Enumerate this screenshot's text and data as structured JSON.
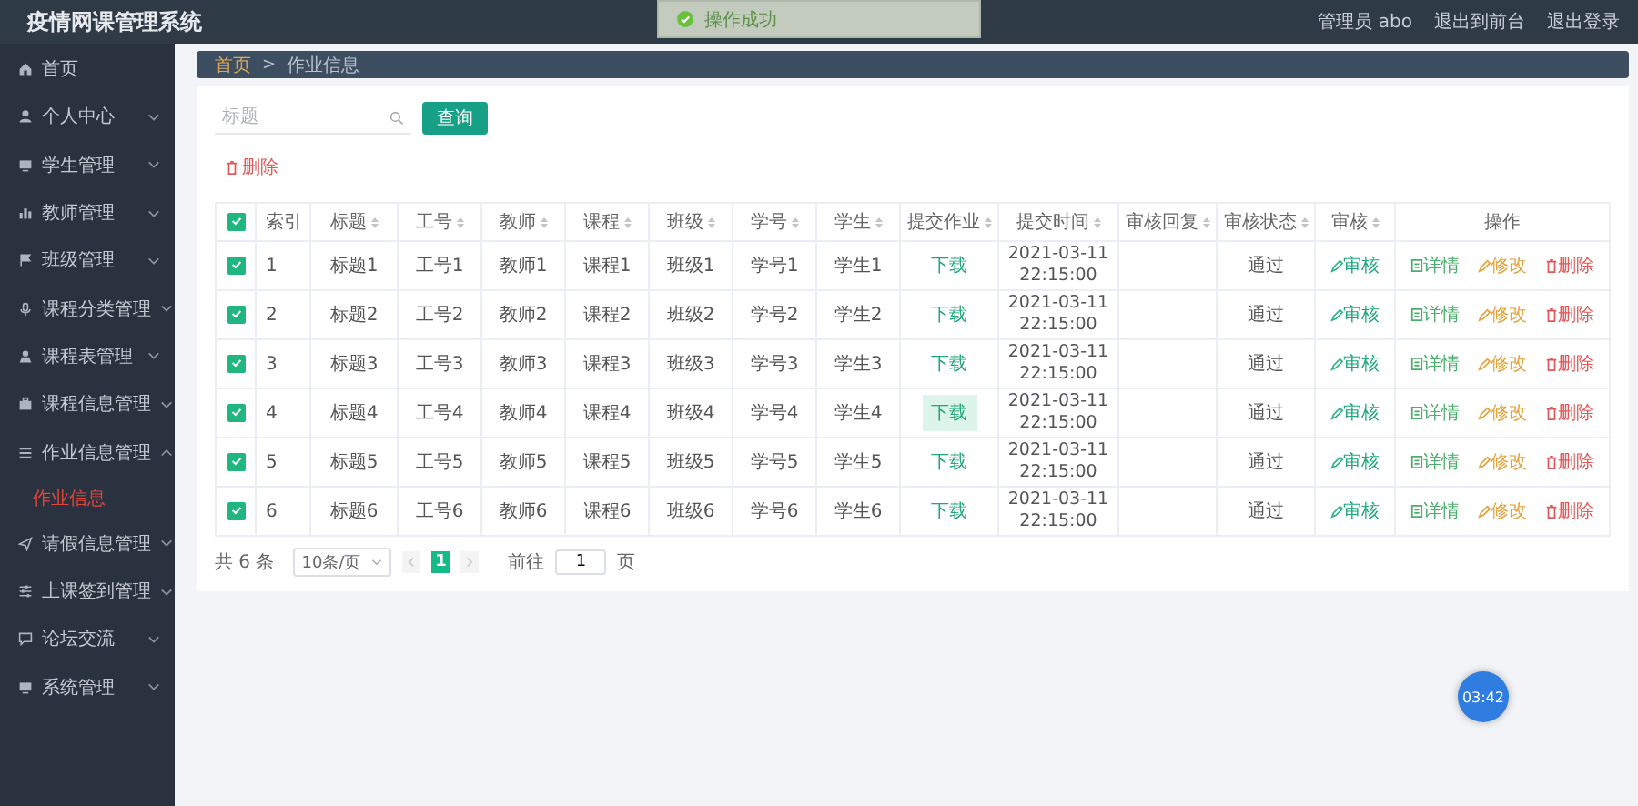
{
  "app_title": "疫情网课管理系统",
  "toast": {
    "text": "操作成功"
  },
  "user_menu": [
    "管理员 abo",
    "退出到前台",
    "退出登录"
  ],
  "sidebar": {
    "items": [
      {
        "label": "首页"
      },
      {
        "label": "个人中心",
        "expanded": false
      },
      {
        "label": "学生管理",
        "expanded": false
      },
      {
        "label": "教师管理",
        "expanded": false
      },
      {
        "label": "班级管理",
        "expanded": false
      },
      {
        "label": "课程分类管理",
        "expanded": false
      },
      {
        "label": "课程表管理",
        "expanded": false
      },
      {
        "label": "课程信息管理",
        "expanded": false
      },
      {
        "label": "作业信息管理",
        "expanded": true,
        "children": [
          {
            "label": "作业信息",
            "selected": true
          }
        ]
      },
      {
        "label": "请假信息管理",
        "expanded": false
      },
      {
        "label": "上课签到管理",
        "expanded": false
      },
      {
        "label": "论坛交流",
        "expanded": false
      },
      {
        "label": "系统管理",
        "expanded": false
      }
    ]
  },
  "breadcrumb": {
    "items": [
      "首页",
      "作业信息"
    ],
    "separator": ">"
  },
  "search": {
    "placeholder": "标题",
    "button": "查询"
  },
  "delete_button": "删除",
  "table": {
    "all_checked": true,
    "columns": [
      {
        "label": "索引",
        "sortable": false
      },
      {
        "label": "标题",
        "sortable": true
      },
      {
        "label": "工号",
        "sortable": true
      },
      {
        "label": "教师",
        "sortable": true
      },
      {
        "label": "课程",
        "sortable": true
      },
      {
        "label": "班级",
        "sortable": true
      },
      {
        "label": "学号",
        "sortable": true
      },
      {
        "label": "学生",
        "sortable": true
      },
      {
        "label": "提交作业",
        "sortable": true
      },
      {
        "label": "提交时间",
        "sortable": true
      },
      {
        "label": "审核回复",
        "sortable": true
      },
      {
        "label": "审核状态",
        "sortable": true
      },
      {
        "label": "审核",
        "sortable": true
      },
      {
        "label": "操作",
        "sortable": false
      }
    ],
    "rows": [
      {
        "checked": true,
        "cells": [
          "1",
          "标题1",
          "工号1",
          "教师1",
          "课程1",
          "班级1",
          "学号1",
          "学生1"
        ],
        "download": "下载",
        "download_highlighted": false,
        "time": "2021-03-11 22:15:00",
        "status": "通过",
        "review": "审核",
        "actions": [
          "详情",
          "修改",
          "删除"
        ]
      },
      {
        "checked": true,
        "cells": [
          "2",
          "标题2",
          "工号2",
          "教师2",
          "课程2",
          "班级2",
          "学号2",
          "学生2"
        ],
        "download": "下载",
        "download_highlighted": false,
        "time": "2021-03-11 22:15:00",
        "status": "通过",
        "review": "审核",
        "actions": [
          "详情",
          "修改",
          "删除"
        ]
      },
      {
        "checked": true,
        "cells": [
          "3",
          "标题3",
          "工号3",
          "教师3",
          "课程3",
          "班级3",
          "学号3",
          "学生3"
        ],
        "download": "下载",
        "download_highlighted": false,
        "time": "2021-03-11 22:15:00",
        "status": "通过",
        "review": "审核",
        "actions": [
          "详情",
          "修改",
          "删除"
        ]
      },
      {
        "checked": true,
        "cells": [
          "4",
          "标题4",
          "工号4",
          "教师4",
          "课程4",
          "班级4",
          "学号4",
          "学生4"
        ],
        "download": "下载",
        "download_highlighted": true,
        "time": "2021-03-11 22:15:00",
        "status": "通过",
        "review": "审核",
        "actions": [
          "详情",
          "修改",
          "删除"
        ]
      },
      {
        "checked": true,
        "cells": [
          "5",
          "标题5",
          "工号5",
          "教师5",
          "课程5",
          "班级5",
          "学号5",
          "学生5"
        ],
        "download": "下载",
        "download_highlighted": false,
        "time": "2021-03-11 22:15:00",
        "status": "通过",
        "review": "审核",
        "actions": [
          "详情",
          "修改",
          "删除"
        ]
      },
      {
        "checked": true,
        "cells": [
          "6",
          "标题6",
          "工号6",
          "教师6",
          "课程6",
          "班级6",
          "学号6",
          "学生6"
        ],
        "download": "下载",
        "download_highlighted": false,
        "time": "2021-03-11 22:15:00",
        "status": "通过",
        "review": "审核",
        "actions": [
          "详情",
          "修改",
          "删除"
        ]
      }
    ]
  },
  "pagination": {
    "total": "共 6 条",
    "page_size": "10条/页",
    "pages": [
      {
        "label": "1",
        "selected": true
      }
    ],
    "goto_label": "前往",
    "goto_value": "1",
    "goto_unit": "页"
  },
  "timer_badge": "03:42"
}
